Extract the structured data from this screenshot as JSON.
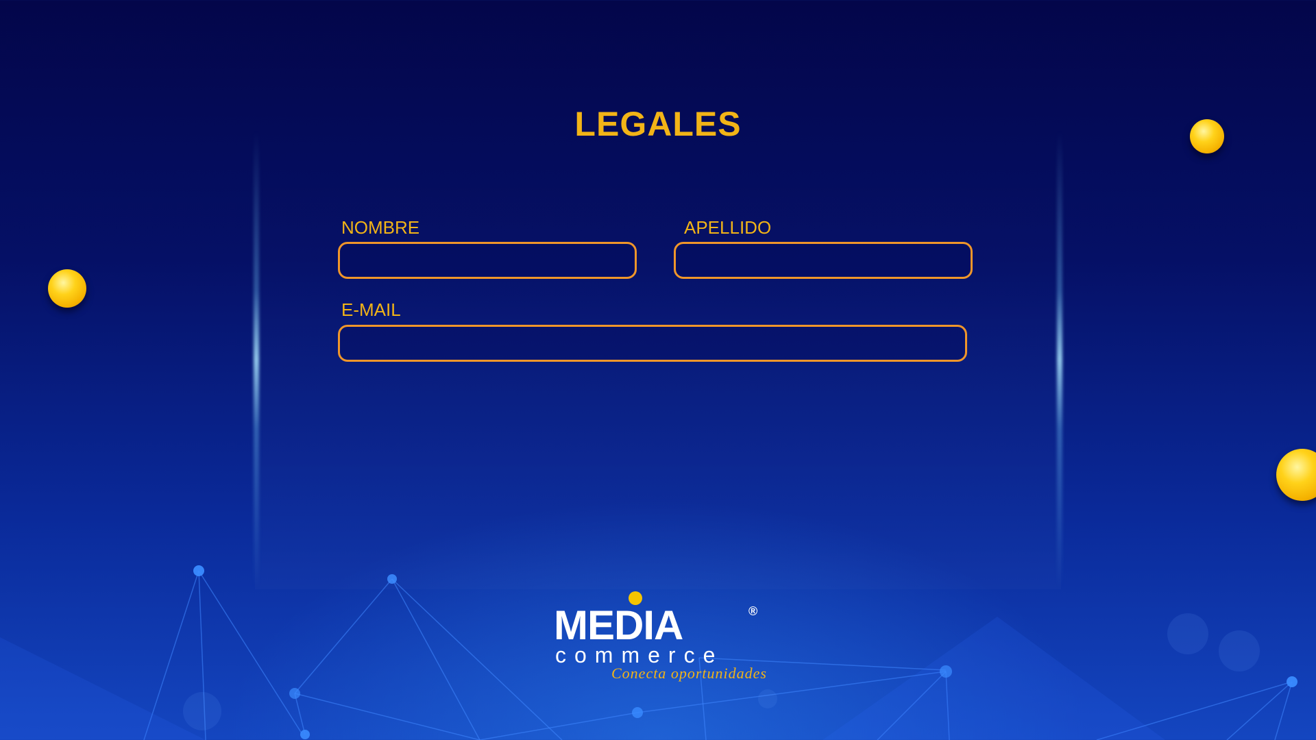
{
  "page": {
    "title": "LEGALES"
  },
  "form": {
    "nombre": {
      "label": "NOMBRE",
      "value": "",
      "placeholder": ""
    },
    "apellido": {
      "label": "APELLIDO",
      "value": "",
      "placeholder": ""
    },
    "email": {
      "label": "E-MAIL",
      "value": "",
      "placeholder": ""
    }
  },
  "brand": {
    "name": "MEDIA",
    "sub": "commerce",
    "registered_mark": "®",
    "tagline": "Conecta oportunidades"
  },
  "colors": {
    "accent_text": "#f2b417",
    "field_border": "#f0962a",
    "background_top": "#03064a",
    "background_bottom": "#1446c0"
  },
  "icons": [
    "gold-sphere-icon",
    "network-lines-decoration"
  ]
}
